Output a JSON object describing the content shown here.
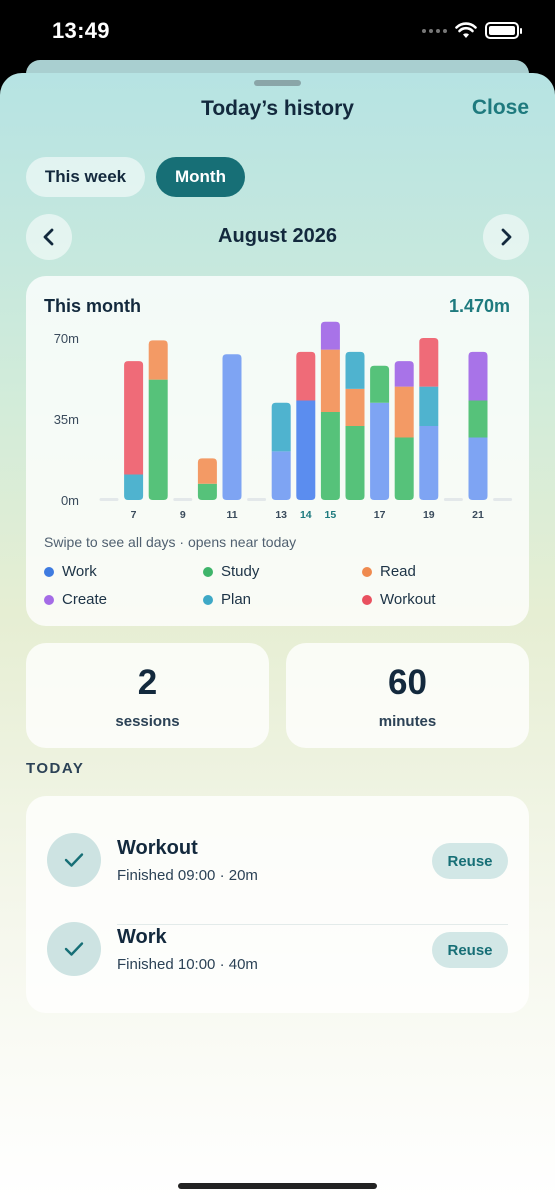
{
  "status_bar": {
    "time": "13:49"
  },
  "sheet": {
    "title": "Today’s history",
    "close_label": "Close"
  },
  "segments": {
    "week_label": "This week",
    "month_label": "Month",
    "selected": "Month"
  },
  "period": {
    "label": "August 2026"
  },
  "chart_card": {
    "title": "This month",
    "total": "1.470m",
    "hint": "Swipe to see all days · opens near today"
  },
  "colors": {
    "accent": "#176f76",
    "accent_text": "#1e7a7e"
  },
  "chart_data": {
    "type": "bar",
    "stacked": true,
    "ylim": [
      0,
      70
    ],
    "yticks": [
      "70m",
      "35m",
      "0m"
    ],
    "ytick_values": [
      70,
      35,
      0
    ],
    "categories": [
      "6",
      "7",
      "8",
      "9",
      "10",
      "11",
      "12",
      "13",
      "14",
      "15",
      "16",
      "17",
      "18",
      "19",
      "20",
      "21",
      "22"
    ],
    "x_tick_labels": [
      "",
      "7",
      "",
      "9",
      "",
      "11",
      "",
      "13",
      "14",
      "15",
      "",
      "17",
      "",
      "19",
      "",
      "21",
      ""
    ],
    "highlighted": [
      "14",
      "15"
    ],
    "series": [
      {
        "name": "Work",
        "color": "#5b8def",
        "values": [
          0,
          0,
          0,
          0,
          0,
          0,
          0,
          0,
          43,
          0,
          0,
          0,
          0,
          0,
          0,
          0,
          0
        ]
      },
      {
        "name": "Study",
        "color": "#56c27a",
        "values": [
          0,
          0,
          52,
          0,
          7,
          0,
          0,
          0,
          0,
          38,
          32,
          28,
          27,
          0,
          0,
          0,
          0
        ]
      },
      {
        "name": "Read",
        "color": "#f39a65",
        "values": [
          0,
          0,
          17,
          0,
          11,
          0,
          0,
          0,
          0,
          27,
          16,
          0,
          22,
          0,
          0,
          37,
          0
        ]
      },
      {
        "name": "Create",
        "color": "#a873e8",
        "values": [
          0,
          0,
          0,
          0,
          0,
          0,
          0,
          0,
          0,
          12,
          0,
          0,
          11,
          0,
          0,
          0,
          0
        ]
      },
      {
        "name": "Plan",
        "color": "#4fb3cf",
        "values": [
          0,
          11,
          0,
          0,
          0,
          0,
          0,
          21,
          0,
          0,
          16,
          0,
          0,
          17,
          0,
          0,
          0
        ]
      },
      {
        "name": "Workout",
        "color": "#ef6b78",
        "values": [
          0,
          49,
          0,
          0,
          0,
          0,
          0,
          0,
          21,
          0,
          0,
          0,
          0,
          21,
          0,
          0,
          0
        ]
      },
      {
        "name": "Work (light)",
        "color": "#7ea4f3",
        "values": [
          0,
          0,
          0,
          0,
          0,
          63,
          0,
          21,
          0,
          0,
          0,
          42,
          0,
          32,
          0,
          0,
          0
        ]
      }
    ],
    "stack_override": {
      "21": [
        {
          "color": "#7ea4f3",
          "value": 27
        },
        {
          "color": "#56c27a",
          "value": 16
        },
        {
          "color": "#a873e8",
          "value": 21
        }
      ]
    }
  },
  "legend": [
    {
      "label": "Work",
      "color": "#3f7be0"
    },
    {
      "label": "Study",
      "color": "#3fb46a"
    },
    {
      "label": "Read",
      "color": "#ef8a4f"
    },
    {
      "label": "Create",
      "color": "#a46be6"
    },
    {
      "label": "Plan",
      "color": "#3ea8c6"
    },
    {
      "label": "Workout",
      "color": "#e9505f"
    }
  ],
  "stats": {
    "sessions_value": "2",
    "sessions_label": "sessions",
    "minutes_value": "60",
    "minutes_label": "minutes"
  },
  "today": {
    "heading": "TODAY",
    "items": [
      {
        "name": "Workout",
        "detail": "Finished 09:00 · 20m",
        "action": "Reuse"
      },
      {
        "name": "Work",
        "detail": "Finished 10:00 · 40m",
        "action": "Reuse"
      }
    ]
  }
}
